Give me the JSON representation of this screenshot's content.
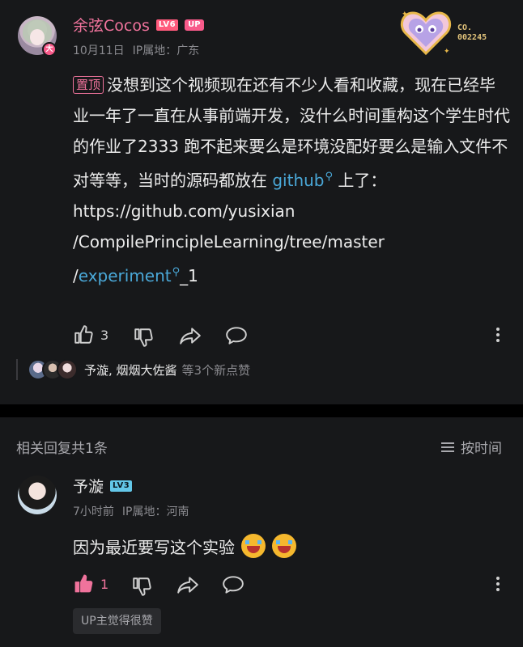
{
  "comment": {
    "username": "余弦Cocos",
    "level_tag": "LV6",
    "up_tag": "UP",
    "avatar_badge": "大",
    "date": "10月11日",
    "ip_location": "IP属地：广东",
    "deco_number_line1": "CO.",
    "deco_number_line2": "002245",
    "pinned_label": "置顶",
    "text_part1": "没想到这个视频现在还有不少人看和收藏，现在已经毕业一年了一直在从事前端开发，没什么时间重构这个学生时代的作业了2333 跑不起来要么是环境没配好要么是输入文件不对等等，当时的源码都放在 ",
    "link1": "github",
    "text_part2": " 上了：",
    "url_line1": "https://github.com/yusixian",
    "url_line2": "/CompilePrincipleLearning/tree/master",
    "url_line3_prefix": "/",
    "link2": "experiment",
    "url_line3_suffix": "_1",
    "like_count": "3",
    "likers_names": "予漩, 烟烟大佐酱",
    "likers_tail": "等3个新点赞"
  },
  "replies": {
    "header": "相关回复共1条",
    "sort_label": "按时间",
    "items": [
      {
        "username": "予漩",
        "level_tag": "LV3",
        "time": "7小时前",
        "ip_location": "IP属地：河南",
        "text": "因为最近要写这个实验",
        "like_count": "1",
        "up_liked": "UP主觉得很赞"
      }
    ]
  },
  "colors": {
    "accent_pink": "#f0739c",
    "link_blue": "#4aa8d8",
    "background": "#17181a"
  }
}
